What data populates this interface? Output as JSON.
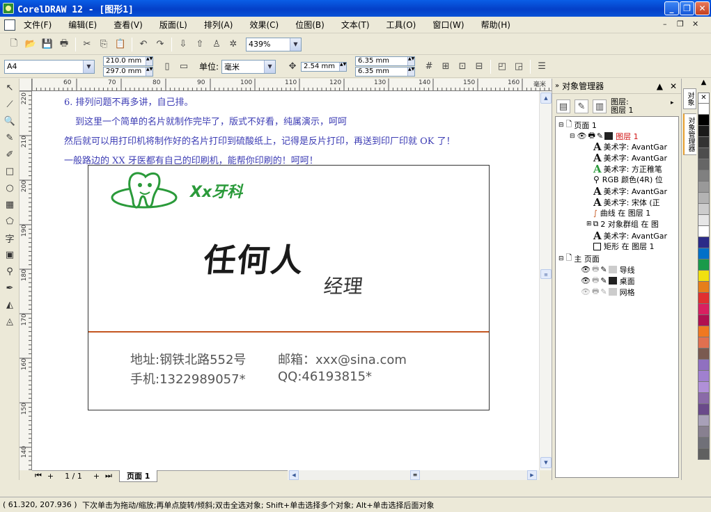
{
  "window": {
    "title": "CorelDRAW 12 - [图形1]",
    "min": "_",
    "max": "❐",
    "close": "✕"
  },
  "menu": [
    "文件(F)",
    "编辑(E)",
    "查看(V)",
    "版面(L)",
    "排列(A)",
    "效果(C)",
    "位图(B)",
    "文本(T)",
    "工具(O)",
    "窗口(W)",
    "帮助(H)"
  ],
  "toolbar": {
    "zoom": "439%"
  },
  "propbar": {
    "paper": "A4",
    "width": "210.0 mm",
    "height": "297.0 mm",
    "unit_label": "单位:",
    "unit": "毫米",
    "nudge": "2.54 mm",
    "dup_x": "6.35 mm",
    "dup_y": "6.35 mm"
  },
  "ruler": {
    "h": [
      "60",
      "70",
      "80",
      "90",
      "100",
      "110",
      "120",
      "130",
      "140",
      "150",
      "160",
      "毫米"
    ],
    "v": [
      "220",
      "210",
      "200",
      "190",
      "180",
      "170",
      "160",
      "150",
      "140",
      "毫米"
    ]
  },
  "canvas_text": [
    "6. 排列问题不再多讲，自己排。",
    "到这里一个简单的名片就制作完毕了，版式不好看，纯属演示，呵呵",
    "然后就可以用打印机将制作好的名片打印到硫酸纸上，记得是反片打印，再送到印厂印就 OK 了！",
    "一般路边的 XX 牙医都有自己的印刷机，能帮你印刷的！呵呵！"
  ],
  "card": {
    "brand": "Xx牙科",
    "name": "任何人",
    "title": "经理",
    "address": "地址:钢铁北路552号",
    "email": "邮箱：xxx@sina.com",
    "phone": "手机:1322989057*",
    "qq": "QQ:46193815*"
  },
  "pagebar": {
    "pages": "1 / 1",
    "tab": "页面 1"
  },
  "objmgr": {
    "title": "对象管理器",
    "layer_label": "图层:",
    "layer_name": "图层 1",
    "page_node": "页面 1",
    "layer_node": "图层 1",
    "items": [
      "美术字: AvantGar",
      "美术字: AvantGar",
      "美术字: 方正稚笔",
      "RGB 颜色(4R) 位",
      "美术字: AvantGar",
      "美术字: 宋体 (正",
      "曲线 在 图层 1",
      "2 对象群组 在 图",
      "美术字: AvantGar",
      "矩形 在 图层 1"
    ],
    "master": "主 页面",
    "master_items": [
      "导线",
      "桌面",
      "网格"
    ]
  },
  "sidetabs": [
    "对象",
    "对象管理器"
  ],
  "palette": [
    "#ffffff",
    "#000000",
    "#1a1a1a",
    "#333333",
    "#4d4d4d",
    "#666666",
    "#808080",
    "#999999",
    "#b3b3b3",
    "#cccccc",
    "#e6e6e6",
    "#ffffff",
    "#2b2b88",
    "#0070c8",
    "#1a9a4a",
    "#f0e010",
    "#e67e1a",
    "#e03030",
    "#d92060",
    "#b01050",
    "#f07820",
    "#e07050",
    "#7a5a50",
    "#9070c0",
    "#a080d0",
    "#b090d8",
    "#8a6aa8",
    "#6a4a8a",
    "#a8a0b8",
    "#888090",
    "#707078",
    "#606060"
  ],
  "status": {
    "coords": "( 61.320, 207.936 )",
    "hint": "下次单击为拖动/缩放;再单点旋转/倾斜;双击全选对象; Shift+单击选择多个对象; Alt+单击选择后面对象"
  }
}
